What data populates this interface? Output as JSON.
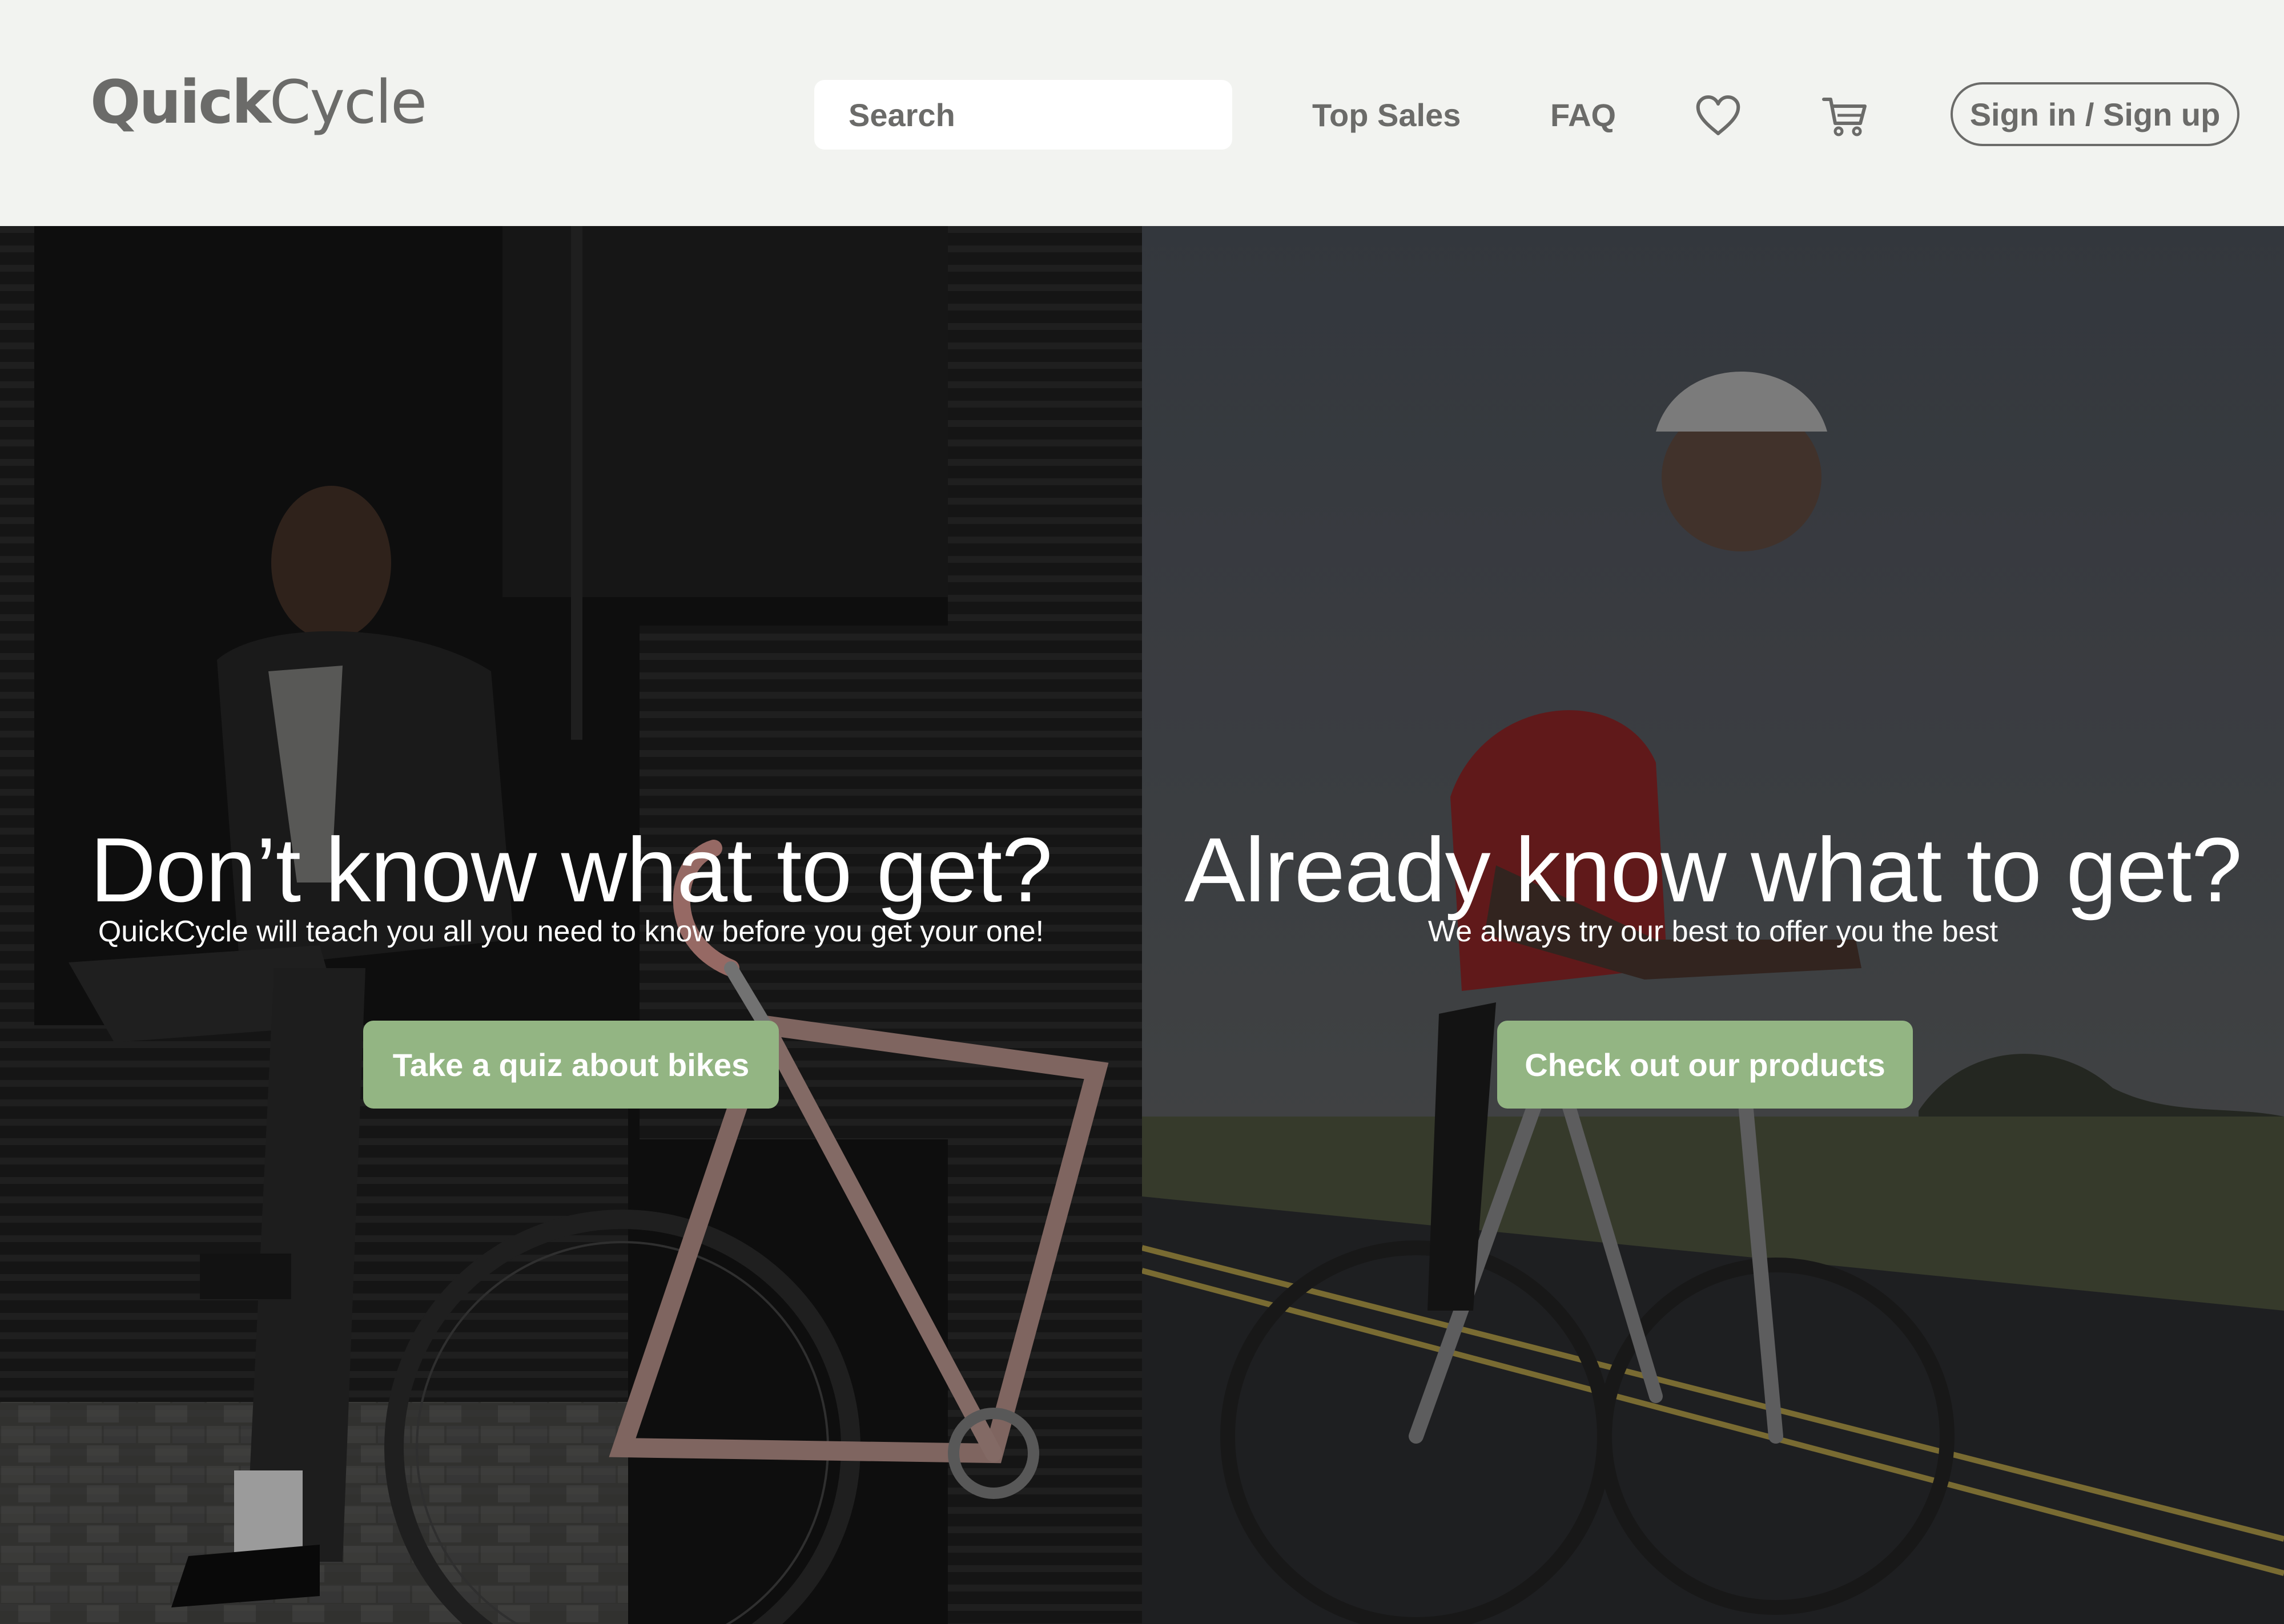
{
  "header": {
    "logo": {
      "bold": "Quick",
      "light": "Cycle"
    },
    "search": {
      "placeholder": "Search",
      "icon": "search-icon"
    },
    "nav": {
      "top_sales": "Top Sales",
      "faq": "FAQ"
    },
    "icons": {
      "wishlist": "heart-icon",
      "cart": "cart-icon"
    },
    "signin_label": "Sign in / Sign up"
  },
  "hero": {
    "left": {
      "heading": "Don’t know what to get?",
      "subtext": "QuickCycle will teach you all you need to know before you get your one!",
      "cta_label": "Take a quiz about bikes"
    },
    "right": {
      "heading": "Already know what to get?",
      "subtext": "We always try our best to offer you the best",
      "cta_label": "Check out our products"
    }
  },
  "colors": {
    "header_bg": "#f2f3f0",
    "text_gray": "#6b6b69",
    "cta_green": "#93b583",
    "hero_text": "#ffffff"
  }
}
